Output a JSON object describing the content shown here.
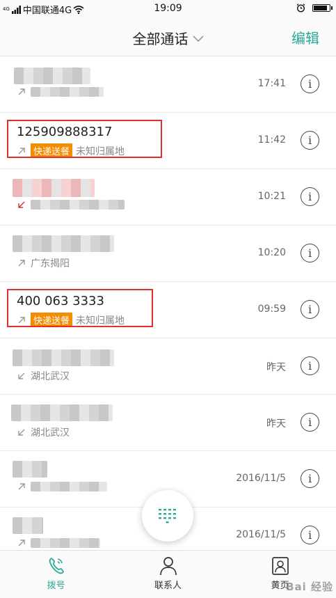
{
  "status_bar": {
    "signal_small": "4G",
    "carrier": "中国联通4G",
    "time": "19:09"
  },
  "header": {
    "title": "全部通话",
    "edit_label": "编辑"
  },
  "calls": [
    {
      "name": "",
      "location": "",
      "time": "17:41",
      "direction": "outgoing"
    },
    {
      "name": "125909888317",
      "tag": "快递送餐",
      "location": "未知归属地",
      "time": "11:42",
      "direction": "outgoing"
    },
    {
      "name": "",
      "location": "",
      "time": "10:21",
      "direction": "missed"
    },
    {
      "name": "",
      "location": "广东揭阳",
      "time": "10:20",
      "direction": "outgoing"
    },
    {
      "name": "400 063 3333",
      "tag": "快递送餐",
      "location": "未知归属地",
      "time": "09:59",
      "direction": "outgoing"
    },
    {
      "name": "",
      "location": "湖北武汉",
      "time": "昨天",
      "direction": "incoming"
    },
    {
      "name": "",
      "location": "湖北武汉",
      "time": "昨天",
      "direction": "incoming"
    },
    {
      "name": "",
      "location": "",
      "time": "2016/11/5",
      "direction": "outgoing"
    },
    {
      "name": "",
      "location": "",
      "time": "2016/11/5",
      "direction": "outgoing"
    }
  ],
  "info_glyph": "i",
  "bottom_nav": {
    "dial": "拨号",
    "contacts": "联系人",
    "yellow_pages": "黄页"
  },
  "watermark": "Bai 经验",
  "colors": {
    "accent": "#2aa89a",
    "tag": "#f48b00",
    "missed": "#d0302a",
    "highlight": "#e03030"
  },
  "icons": {
    "wifi": "wifi-icon",
    "alarm": "alarm-icon",
    "battery": "battery-icon",
    "dropdown": "chevron-down-icon",
    "info": "info-icon",
    "dialpad": "dialpad-icon",
    "phone": "phone-icon",
    "contacts": "person-icon",
    "yellow_pages": "book-icon"
  }
}
